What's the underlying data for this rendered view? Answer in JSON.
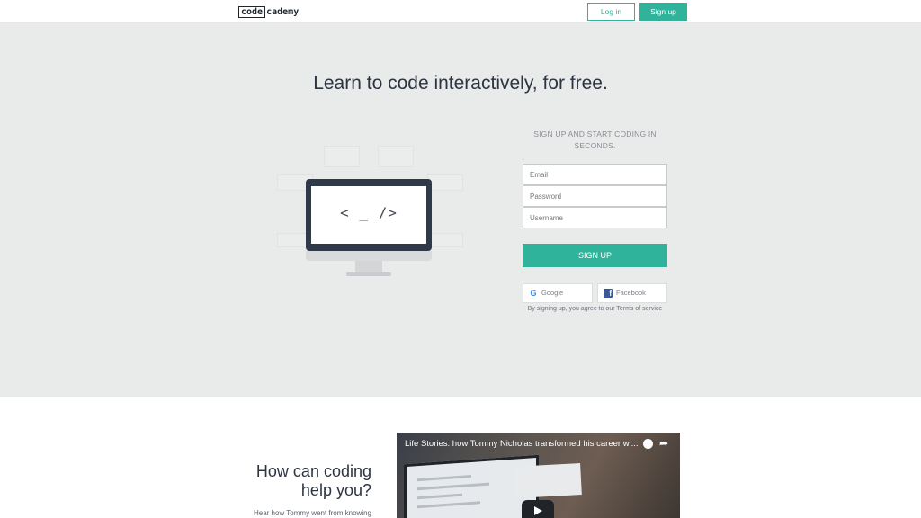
{
  "nav": {
    "logo_part1": "code",
    "logo_part2": "cademy",
    "login_label": "Log in",
    "signup_label": "Sign up"
  },
  "hero": {
    "title": "Learn to code interactively, for free.",
    "illustration_code": "< _ />",
    "form": {
      "title": "SIGN UP AND START CODING IN SECONDS.",
      "email_placeholder": "Email",
      "password_placeholder": "Password",
      "username_placeholder": "Username",
      "submit_label": "SIGN UP",
      "google_label": "Google",
      "facebook_label": "Facebook",
      "terms_prefix": "By signing up, you agree to our ",
      "terms_link": "Terms of service"
    }
  },
  "help": {
    "title_line1": "How can coding",
    "title_line2": "help you?",
    "text": "Hear how Tommy went from knowing"
  },
  "video": {
    "title": "Life Stories: how Tommy Nicholas transformed his career wi..."
  },
  "colors": {
    "brand_teal": "#2fb39b",
    "hero_bg": "#e9eaea",
    "text_dark": "#2d3542"
  }
}
